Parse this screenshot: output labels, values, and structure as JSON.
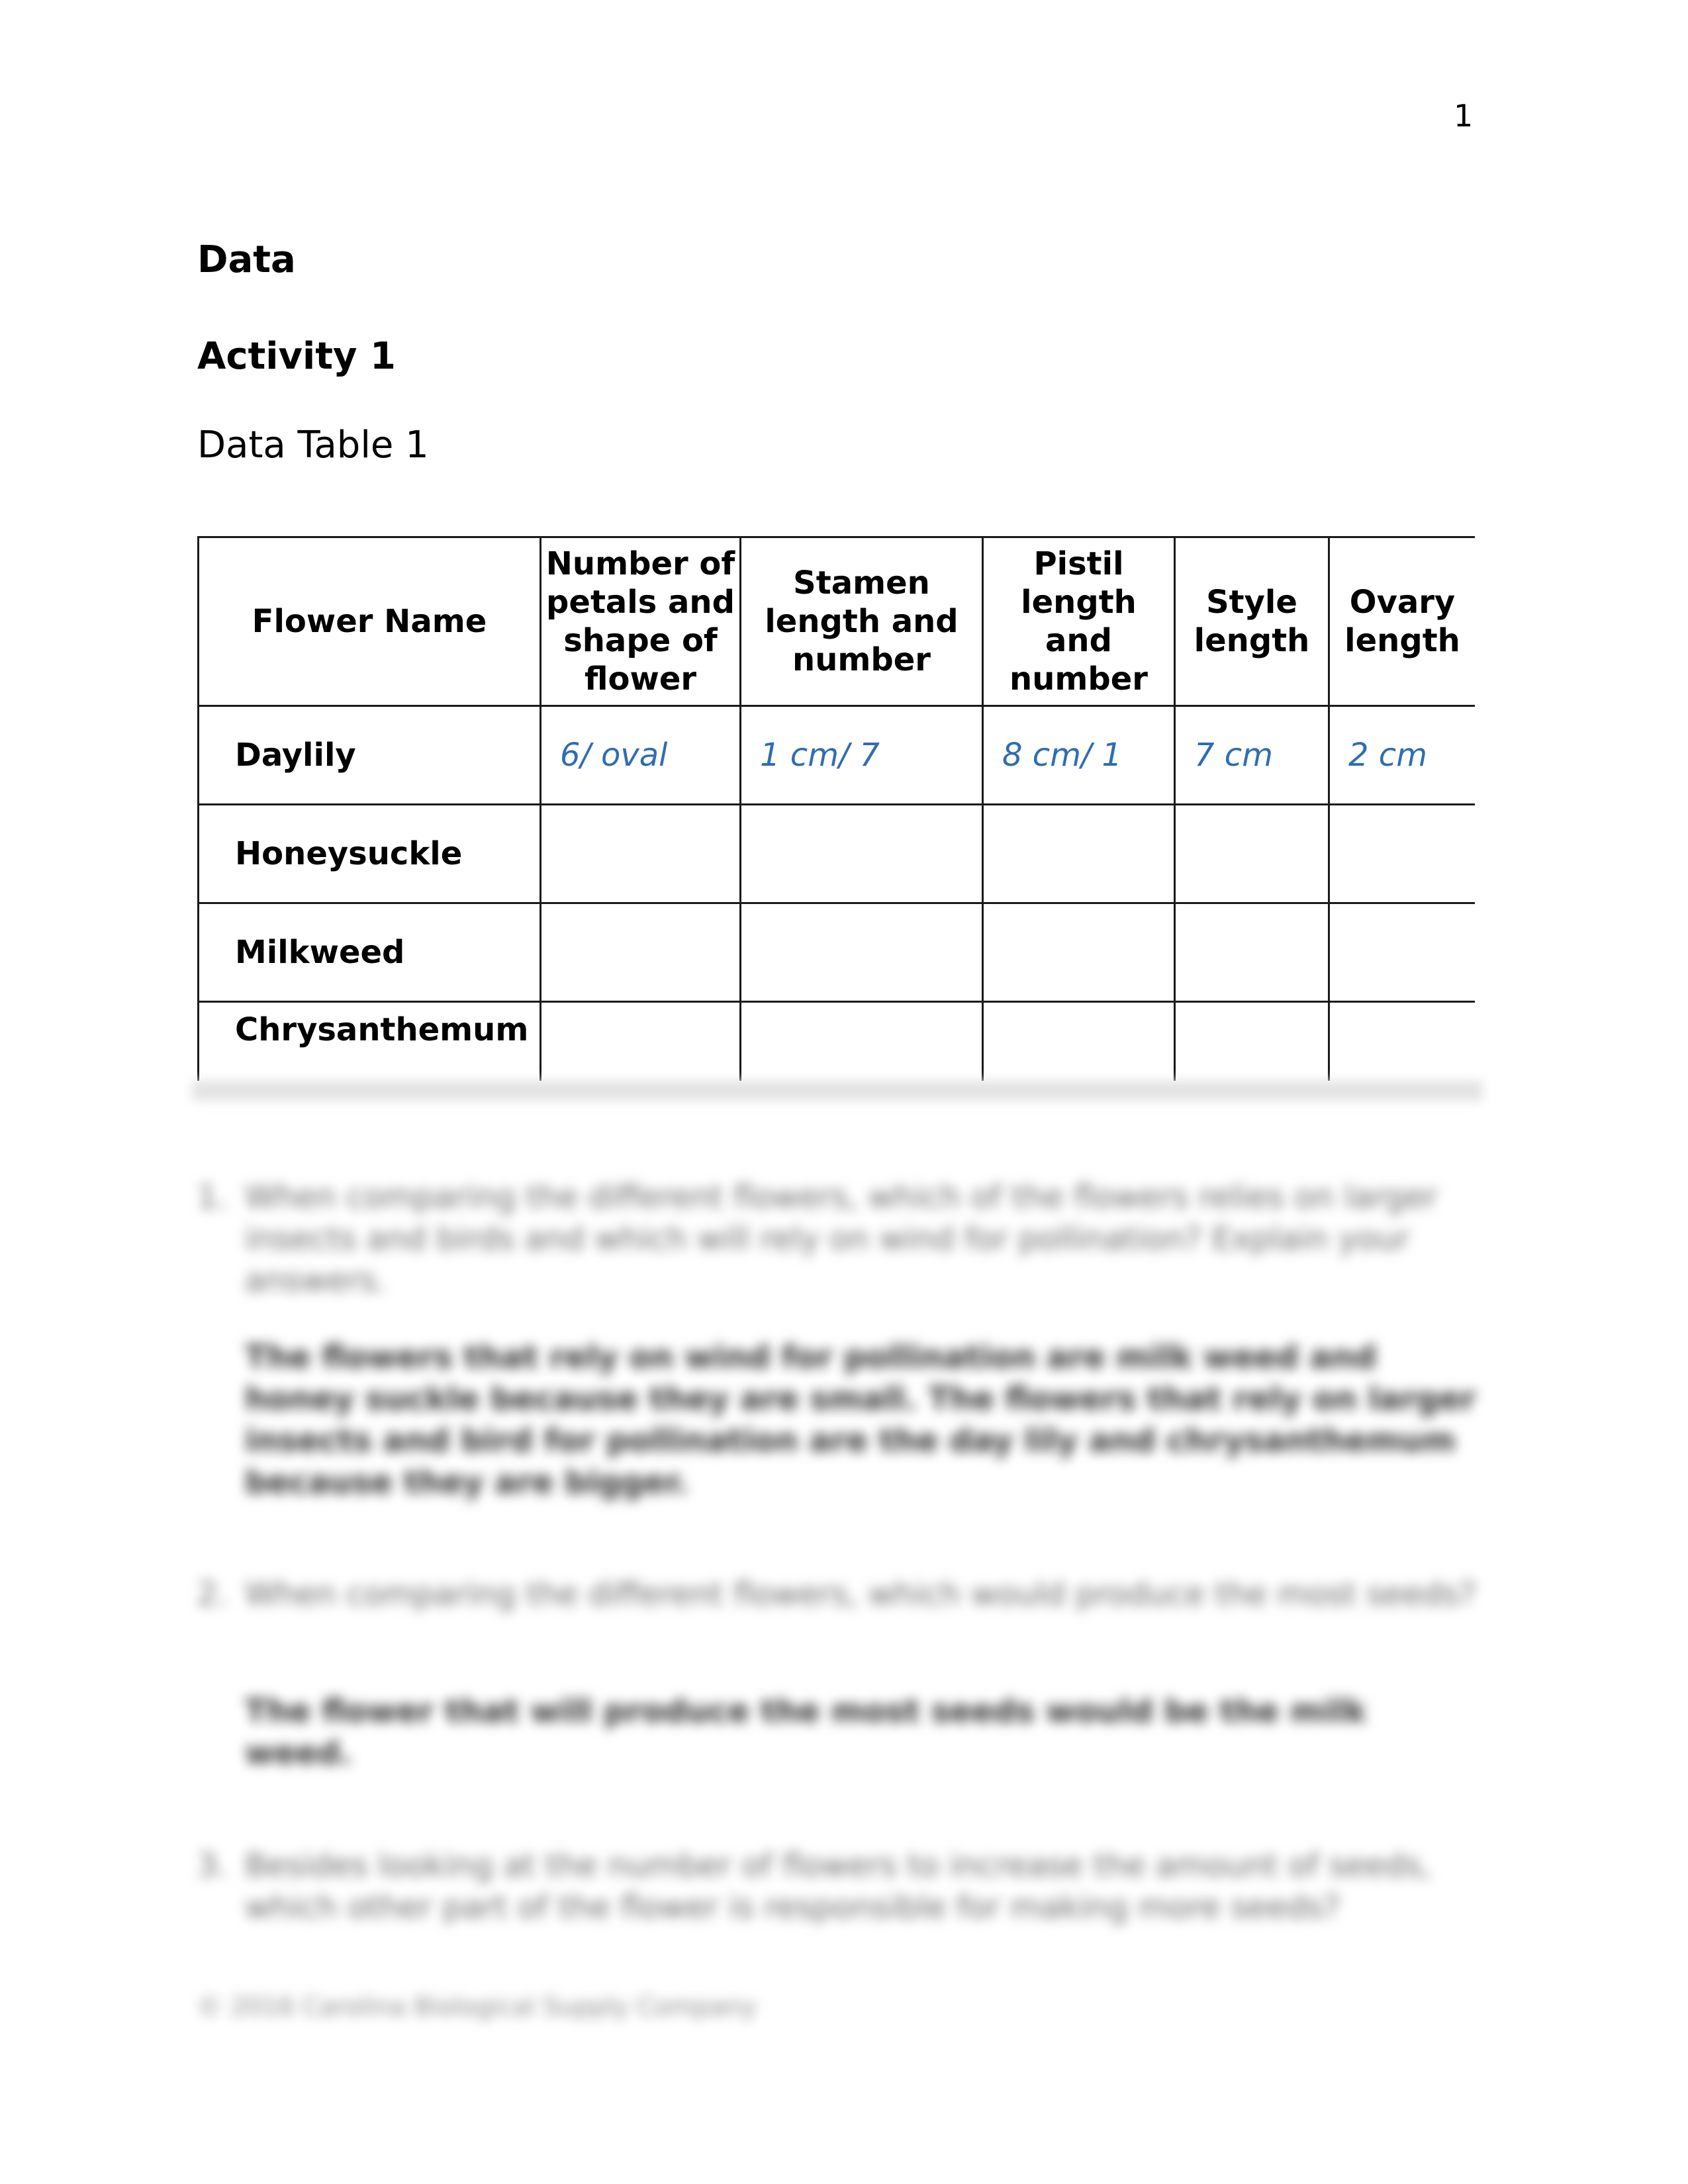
{
  "page_number": "1",
  "section_title": "Data",
  "activity_title": "Activity 1",
  "table_caption": "Data Table 1",
  "table": {
    "headers": [
      "Flower Name",
      "Number of petals and shape of flower",
      "Stamen length and number",
      "Pistil length and number",
      "Style length",
      "Ovary length"
    ],
    "rows": [
      {
        "name": "Daylily",
        "values": [
          "6/ oval",
          "1 cm/ 7",
          "8 cm/ 1",
          "7 cm",
          "2 cm"
        ]
      },
      {
        "name": "Honeysuckle",
        "values": [
          "",
          "",
          "",
          "",
          ""
        ]
      },
      {
        "name": "Milkweed",
        "values": [
          "",
          "",
          "",
          "",
          ""
        ]
      },
      {
        "name": "Chrysanthemum",
        "values": [
          "",
          "",
          "",
          "",
          ""
        ]
      }
    ],
    "value_color": "#2f6db0"
  },
  "questions": [
    {
      "number": "1.",
      "text": "When comparing the different flowers, which of the flowers relies on larger insects and birds and which will rely on wind for pollination? Explain your answers.",
      "answer": "The flowers that rely on wind for pollination are milk weed and honey suckle because they are small. The flowers that rely on larger insects and bird for pollination are the day lily and chrysanthemum because they are bigger."
    },
    {
      "number": "2.",
      "text": "When comparing the different flowers, which would produce the most seeds?",
      "answer": "The flower that will produce the most seeds would be the milk weed."
    },
    {
      "number": "3.",
      "text": "Besides looking at the number of flowers to increase the amount of seeds, which other part of the flower is responsible for making more seeds?",
      "answer": ""
    }
  ],
  "footer": "© 2016 Carolina Biological Supply Company"
}
